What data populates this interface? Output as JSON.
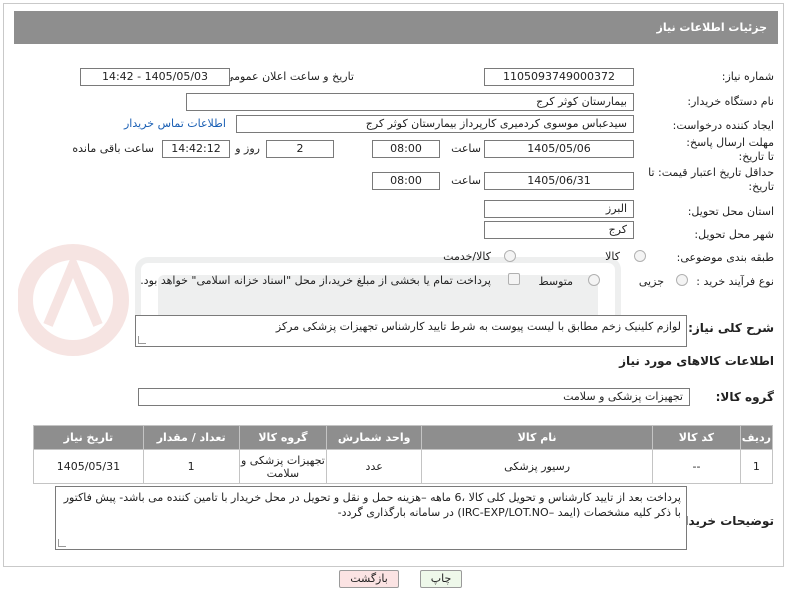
{
  "header": {
    "title": "جزئیات اطلاعات نیاز"
  },
  "form": {
    "need_number": {
      "label": "شماره نیاز:",
      "value": "1105093749000372"
    },
    "announce_date": {
      "label": "تاریخ و ساعت اعلان عمومی:",
      "value": "1405/05/03 - 14:42"
    },
    "buyer_org": {
      "label": "نام دستگاه خریدار:",
      "value": "بیمارستان کوثر کرج"
    },
    "requester": {
      "label": "ایجاد کننده درخواست:",
      "value": "سیدعباس موسوی کردمیری کارپرداز بیمارستان کوثر کرج",
      "contact_link": "اطلاعات تماس خریدار"
    },
    "response_deadline": {
      "label": "مهلت ارسال پاسخ: تا تاریخ:",
      "date": "1405/05/06",
      "time_label": "ساعت",
      "time": "08:00",
      "days": "2",
      "days_label": "روز و",
      "remaining": "14:42:12",
      "remaining_label": "ساعت باقی مانده"
    },
    "price_validity": {
      "label": "حداقل تاریخ اعتبار قیمت: تا تاریخ:",
      "date": "1405/06/31",
      "time_label": "ساعت",
      "time": "08:00"
    },
    "province": {
      "label": "استان محل تحویل:",
      "value": "البرز"
    },
    "city": {
      "label": "شهر محل تحویل:",
      "value": "کرج"
    },
    "category": {
      "label": "طبقه بندی موضوعی:",
      "options": [
        "کالا",
        "کالا/خدمت"
      ]
    },
    "process": {
      "label": "نوع فرآیند خرید :",
      "options": [
        "جزیی",
        "متوسط"
      ],
      "treasury_note": "پرداخت تمام یا بخشی از مبلغ خرید،از محل \"اسناد خزانه اسلامی\" خواهد بود."
    },
    "general_desc": {
      "label": "شرح کلی نیاز:",
      "value": "لوازم کلینیک زخم مطابق با لیست پیوست به شرط تایید کارشناس تجهیزات پزشکی مرکز"
    }
  },
  "goods": {
    "section_title": "اطلاعات کالاهای مورد نیاز",
    "group_label": "گروه کالا:",
    "group_value": "تجهیزات پزشکی و سلامت",
    "columns": [
      "ردیف",
      "کد کالا",
      "نام کالا",
      "واحد شمارش",
      "گروه کالا",
      "تعداد / مقدار",
      "تاریخ نیاز"
    ],
    "rows": [
      {
        "row": "1",
        "code": "--",
        "name": "رسیور پزشکی",
        "unit": "عدد",
        "group": "تجهیزات پزشکی و سلامت",
        "qty": "1",
        "date": "1405/05/31"
      }
    ]
  },
  "buyer_notes": {
    "label": "توضیحات خریدار:",
    "value": "پرداخت بعد از تایید کارشناس و تحویل کلی کالا ،6 ماهه –هزینه حمل و نقل و تحویل در محل خریدار با تامین کننده می باشد- پیش فاکتور با ذکر کلیه مشخصات (ایمد –IRC-EXP/LOT.NO) در سامانه بارگذاری گردد-"
  },
  "buttons": {
    "print": "چاپ",
    "back": "بازگشت"
  },
  "colors": {
    "header_bg": "#8e8e8e",
    "link": "#1a5fb4",
    "back_btn_bg": "#fbe3e3",
    "print_btn_bg": "#eef8ea"
  }
}
